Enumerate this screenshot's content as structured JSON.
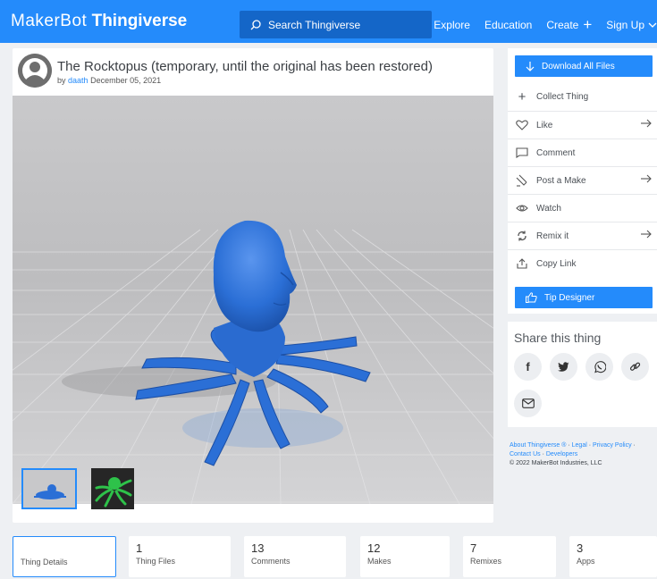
{
  "header": {
    "logo_makerbot": "MakerBot",
    "logo_thingiverse": "Thingiverse",
    "search_placeholder": "Search Thingiverse",
    "nav": {
      "explore": "Explore",
      "education": "Education",
      "create": "Create",
      "signup": "Sign Up"
    }
  },
  "thing": {
    "title": "The Rocktopus (temporary, until the original has been restored)",
    "by": "by",
    "author": "daath",
    "date": "December 05, 2021"
  },
  "actions": {
    "download_all": "Download All Files",
    "collect": "Collect Thing",
    "like": "Like",
    "comment": "Comment",
    "post_make": "Post a Make",
    "watch": "Watch",
    "remix": "Remix it",
    "copy_link": "Copy Link",
    "tip": "Tip Designer"
  },
  "share": {
    "title": "Share this thing"
  },
  "footer": {
    "about": "About Thingiverse ®",
    "sep": " · ",
    "legal": "Legal",
    "privacy": "Privacy Policy",
    "contact": "Contact Us",
    "developers": "Developers",
    "copyright": "© 2022 MakerBot Industries, LLC"
  },
  "tabs": [
    {
      "num": "",
      "label": "Thing Details"
    },
    {
      "num": "1",
      "label": "Thing Files"
    },
    {
      "num": "13",
      "label": "Comments"
    },
    {
      "num": "12",
      "label": "Makes"
    },
    {
      "num": "7",
      "label": "Remixes"
    },
    {
      "num": "3",
      "label": "Apps"
    }
  ],
  "colors": {
    "brand": "#248bfb",
    "model": "#2b6fd6"
  }
}
